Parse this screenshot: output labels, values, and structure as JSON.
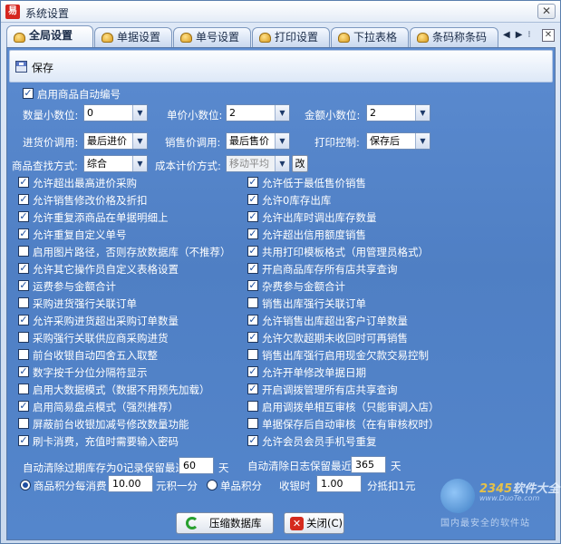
{
  "window": {
    "title": "系统设置",
    "app_icon_text": "易",
    "close_glyph": "✕"
  },
  "tabs": [
    {
      "label": "全局设置",
      "active": true
    },
    {
      "label": "单据设置",
      "active": false
    },
    {
      "label": "单号设置",
      "active": false
    },
    {
      "label": "打印设置",
      "active": false
    },
    {
      "label": "下拉表格",
      "active": false
    },
    {
      "label": "条码称条码",
      "active": false
    }
  ],
  "tab_nav": {
    "prev": "◀",
    "next": "▶",
    "menu": "✕"
  },
  "toolbar": {
    "save_label": "保存"
  },
  "auto_number": {
    "label": "启用商品自动编号",
    "checked": true
  },
  "decimals": [
    {
      "label": "数量小数位:",
      "value": "0"
    },
    {
      "label": "单价小数位:",
      "value": "2"
    },
    {
      "label": "金额小数位:",
      "value": "2"
    }
  ],
  "price_call": [
    {
      "label": "进货价调用:",
      "value": "最后进价"
    },
    {
      "label": "销售价调用:",
      "value": "最后售价"
    },
    {
      "label": "打印控制:",
      "value": "保存后"
    }
  ],
  "search": {
    "label": "商品查找方式:",
    "value": "综合"
  },
  "cost": {
    "label": "成本计价方式:",
    "value": "移动平均",
    "change_button": "改"
  },
  "left_options": [
    {
      "label": "允许超出最高进价采购",
      "checked": true
    },
    {
      "label": "允许销售修改价格及折扣",
      "checked": true
    },
    {
      "label": "允许重复添商品在单据明细上",
      "checked": true
    },
    {
      "label": "允许重复自定义单号",
      "checked": true
    },
    {
      "label": "启用图片路径，否则存放数据库（不推荐）",
      "checked": false
    },
    {
      "label": "允许其它操作员自定义表格设置",
      "checked": true
    },
    {
      "label": "运费参与金额合计",
      "checked": true
    },
    {
      "label": "采购进货强行关联订单",
      "checked": false
    },
    {
      "label": "允许采购进货超出采购订单数量",
      "checked": true
    },
    {
      "label": "采购强行关联供应商采购进货",
      "checked": false
    },
    {
      "label": "前台收银自动四舍五入取整",
      "checked": false
    },
    {
      "label": "数字按千分位分隔符显示",
      "checked": true
    },
    {
      "label": "启用大数据模式（数据不用预先加载）",
      "checked": false
    },
    {
      "label": "启用简易盘点模式（强烈推荐）",
      "checked": true
    },
    {
      "label": "屏蔽前台收银加减号修改数量功能",
      "checked": false
    },
    {
      "label": "刷卡消费，充值时需要输入密码",
      "checked": true
    }
  ],
  "right_options": [
    {
      "label": "允许低于最低售价销售",
      "checked": true
    },
    {
      "label": "允许0库存出库",
      "checked": true
    },
    {
      "label": "允许出库时调出库存数量",
      "checked": true
    },
    {
      "label": "允许超出信用额度销售",
      "checked": true
    },
    {
      "label": "共用打印模板格式（用管理员格式）",
      "checked": true
    },
    {
      "label": "开启商品库存所有店共享查询",
      "checked": true
    },
    {
      "label": "杂费参与金额合计",
      "checked": true
    },
    {
      "label": "销售出库强行关联订单",
      "checked": false
    },
    {
      "label": "允许销售出库超出客户订单数量",
      "checked": true
    },
    {
      "label": "允许欠款超期未收回时可再销售",
      "checked": true
    },
    {
      "label": "销售出库强行启用现金欠款交易控制",
      "checked": false
    },
    {
      "label": "允许开单修改单据日期",
      "checked": true
    },
    {
      "label": "开启调拨管理所有店共享查询",
      "checked": true
    },
    {
      "label": "启用调拨单相互审核（只能审调入店）",
      "checked": false
    },
    {
      "label": "单据保存后自动审核（在有审核权时）",
      "checked": false
    },
    {
      "label": "允许会员会员手机号重复",
      "checked": true
    }
  ],
  "auto_clean_left": {
    "prefix": "自动清除过期库存为0记录保留最近",
    "value": "60",
    "suffix": "天"
  },
  "auto_clean_right": {
    "prefix": "自动清除日志保留最近",
    "value": "365",
    "suffix": "天"
  },
  "points": {
    "consume_label": "商品积分每消费",
    "consume_value": "10.00",
    "consume_suffix": "元积一分",
    "single_label": "单品积分",
    "selected": "consume",
    "cash_label": "收银时",
    "cash_value": "1.00",
    "cash_suffix": "分抵扣1元"
  },
  "footer": {
    "compress_button": "压缩数据库",
    "close_button": "关闭(C)",
    "close_glyph": "✕"
  },
  "watermark": {
    "brand": "2345",
    "brand_suffix": "软件大全",
    "url": "www.DuoTe.com",
    "slogan": "国内最安全的软件站"
  }
}
